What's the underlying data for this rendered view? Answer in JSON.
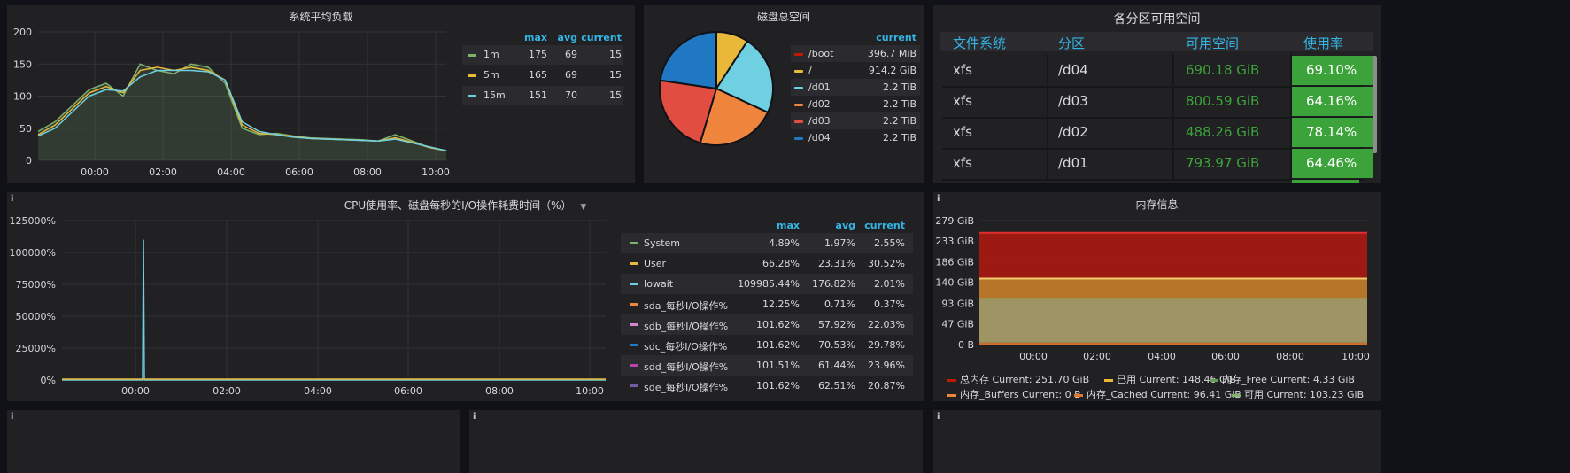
{
  "panels": {
    "load": {
      "title": "系统平均负载",
      "headers": {
        "max": "max",
        "avg": "avg",
        "current": "current"
      },
      "rows": [
        {
          "name": "1m",
          "max": "175",
          "avg": "69",
          "current": "15",
          "color": "#7eb26d"
        },
        {
          "name": "5m",
          "max": "165",
          "avg": "69",
          "current": "15",
          "color": "#eab839"
        },
        {
          "name": "15m",
          "max": "151",
          "avg": "70",
          "current": "15",
          "color": "#6ed0e0"
        }
      ],
      "yticks": [
        "200",
        "150",
        "100",
        "50",
        "0"
      ],
      "xticks": [
        "00:00",
        "02:00",
        "04:00",
        "06:00",
        "08:00",
        "10:00"
      ]
    },
    "disk": {
      "title": "磁盘总空间",
      "header": "current",
      "rows": [
        {
          "name": "/boot",
          "value": "396.7 MiB",
          "color": "#bf1b00"
        },
        {
          "name": "/",
          "value": "914.2 GiB",
          "color": "#eab839"
        },
        {
          "name": "/d01",
          "value": "2.2 TiB",
          "color": "#6ed0e0"
        },
        {
          "name": "/d02",
          "value": "2.2 TiB",
          "color": "#ef843c"
        },
        {
          "name": "/d03",
          "value": "2.2 TiB",
          "color": "#e24d42"
        },
        {
          "name": "/d04",
          "value": "2.2 TiB",
          "color": "#1f78c1"
        }
      ]
    },
    "partitions": {
      "title": "各分区可用空间",
      "headers": {
        "fs": "文件系统",
        "part": "分区",
        "avail": "可用空间",
        "usage": "使用率"
      },
      "rows": [
        {
          "fs": "xfs",
          "part": "/d04",
          "avail": "690.18 GiB",
          "usage": "69.10%"
        },
        {
          "fs": "xfs",
          "part": "/d03",
          "avail": "800.59 GiB",
          "usage": "64.16%"
        },
        {
          "fs": "xfs",
          "part": "/d02",
          "avail": "488.26 GiB",
          "usage": "78.14%"
        },
        {
          "fs": "xfs",
          "part": "/d01",
          "avail": "793.97 GiB",
          "usage": "64.46%"
        }
      ]
    },
    "cpu": {
      "title": "CPU使用率、磁盘每秒的I/O操作耗费时间（%）",
      "headers": {
        "max": "max",
        "avg": "avg",
        "current": "current"
      },
      "rows": [
        {
          "name": "System",
          "max": "4.89%",
          "avg": "1.97%",
          "current": "2.55%",
          "color": "#7eb26d"
        },
        {
          "name": "User",
          "max": "66.28%",
          "avg": "23.31%",
          "current": "30.52%",
          "color": "#eab839"
        },
        {
          "name": "Iowait",
          "max": "109985.44%",
          "avg": "176.82%",
          "current": "2.01%",
          "color": "#6ed0e0"
        },
        {
          "name": "sda_每秒I/O操作%",
          "max": "12.25%",
          "avg": "0.71%",
          "current": "0.37%",
          "color": "#ef843c"
        },
        {
          "name": "sdb_每秒I/O操作%",
          "max": "101.62%",
          "avg": "57.92%",
          "current": "22.03%",
          "color": "#d683ce"
        },
        {
          "name": "sdc_每秒I/O操作%",
          "max": "101.62%",
          "avg": "70.53%",
          "current": "29.78%",
          "color": "#1f78c1"
        },
        {
          "name": "sdd_每秒I/O操作%",
          "max": "101.51%",
          "avg": "61.44%",
          "current": "23.96%",
          "color": "#ba43a9"
        },
        {
          "name": "sde_每秒I/O操作%",
          "max": "101.62%",
          "avg": "62.51%",
          "current": "20.87%",
          "color": "#705da0"
        }
      ],
      "yticks": [
        "125000%",
        "100000%",
        "75000%",
        "50000%",
        "25000%",
        "0%"
      ],
      "xticks": [
        "00:00",
        "02:00",
        "04:00",
        "06:00",
        "08:00",
        "10:00"
      ]
    },
    "mem": {
      "title": "内存信息",
      "yticks": [
        "279 GiB",
        "233 GiB",
        "186 GiB",
        "140 GiB",
        "93 GiB",
        "47 GiB",
        "0 B"
      ],
      "xticks": [
        "00:00",
        "02:00",
        "04:00",
        "06:00",
        "08:00",
        "10:00"
      ],
      "legend": [
        {
          "name": "总内存",
          "cur": "Current: 251.70 GiB",
          "color": "#bf1b00"
        },
        {
          "name": "已用",
          "cur": "Current: 148.46 GiB",
          "color": "#eab839"
        },
        {
          "name": "内存_Free",
          "cur": "Current: 4.33 GiB",
          "color": "#629e51"
        },
        {
          "name": "内存_Buffers",
          "cur": "Current: 0 B",
          "color": "#ef843c"
        },
        {
          "name": "内存_Cached",
          "cur": "Current: 96.41 GiB",
          "color": "#e0752d"
        },
        {
          "name": "可用",
          "cur": "Current: 103.23 GiB",
          "color": "#7eb26d"
        }
      ]
    }
  },
  "chart_data": [
    {
      "type": "line",
      "title": "系统平均负载",
      "ylim": [
        0,
        200
      ],
      "x": [
        "22:30",
        "23:00",
        "23:30",
        "00:00",
        "00:30",
        "01:00",
        "01:30",
        "02:00",
        "02:30",
        "03:00",
        "03:30",
        "04:00",
        "04:30",
        "05:00",
        "05:30",
        "06:00",
        "06:30",
        "07:00",
        "07:30",
        "08:00",
        "08:30",
        "09:00",
        "09:30",
        "10:00",
        "10:15"
      ],
      "series": [
        {
          "name": "1m",
          "values": [
            45,
            60,
            85,
            110,
            120,
            100,
            150,
            140,
            135,
            150,
            145,
            120,
            50,
            40,
            42,
            38,
            35,
            34,
            33,
            32,
            30,
            40,
            30,
            20,
            15
          ]
        },
        {
          "name": "5m",
          "values": [
            40,
            55,
            80,
            105,
            115,
            105,
            140,
            145,
            140,
            145,
            140,
            125,
            55,
            42,
            40,
            37,
            34,
            33,
            32,
            31,
            30,
            35,
            28,
            20,
            15
          ]
        },
        {
          "name": "15m",
          "values": [
            38,
            50,
            75,
            100,
            110,
            108,
            130,
            140,
            140,
            140,
            138,
            125,
            60,
            45,
            40,
            36,
            34,
            33,
            32,
            31,
            30,
            33,
            27,
            21,
            15
          ]
        }
      ]
    },
    {
      "type": "pie",
      "title": "磁盘总空间",
      "categories": [
        "/boot",
        "/",
        "/d01",
        "/d02",
        "/d03",
        "/d04"
      ],
      "values": [
        0.00039,
        0.8928,
        2.2,
        2.2,
        2.2,
        2.2
      ]
    },
    {
      "type": "line",
      "title": "CPU使用率、磁盘每秒的I/O操作耗费时间（%）",
      "ylim": [
        0,
        125000
      ],
      "series": [
        {
          "name": "Iowait",
          "spike_x": "00:05",
          "spike_value": 109985.44
        }
      ]
    },
    {
      "type": "area",
      "title": "内存信息",
      "ylim": [
        0,
        279
      ],
      "series": [
        {
          "name": "总内存",
          "value": 251.7
        },
        {
          "name": "已用",
          "value": 148.46
        },
        {
          "name": "可用",
          "value": 103.23
        },
        {
          "name": "内存_Cached",
          "value": 96.41
        },
        {
          "name": "内存_Free",
          "value": 4.33
        }
      ]
    }
  ]
}
